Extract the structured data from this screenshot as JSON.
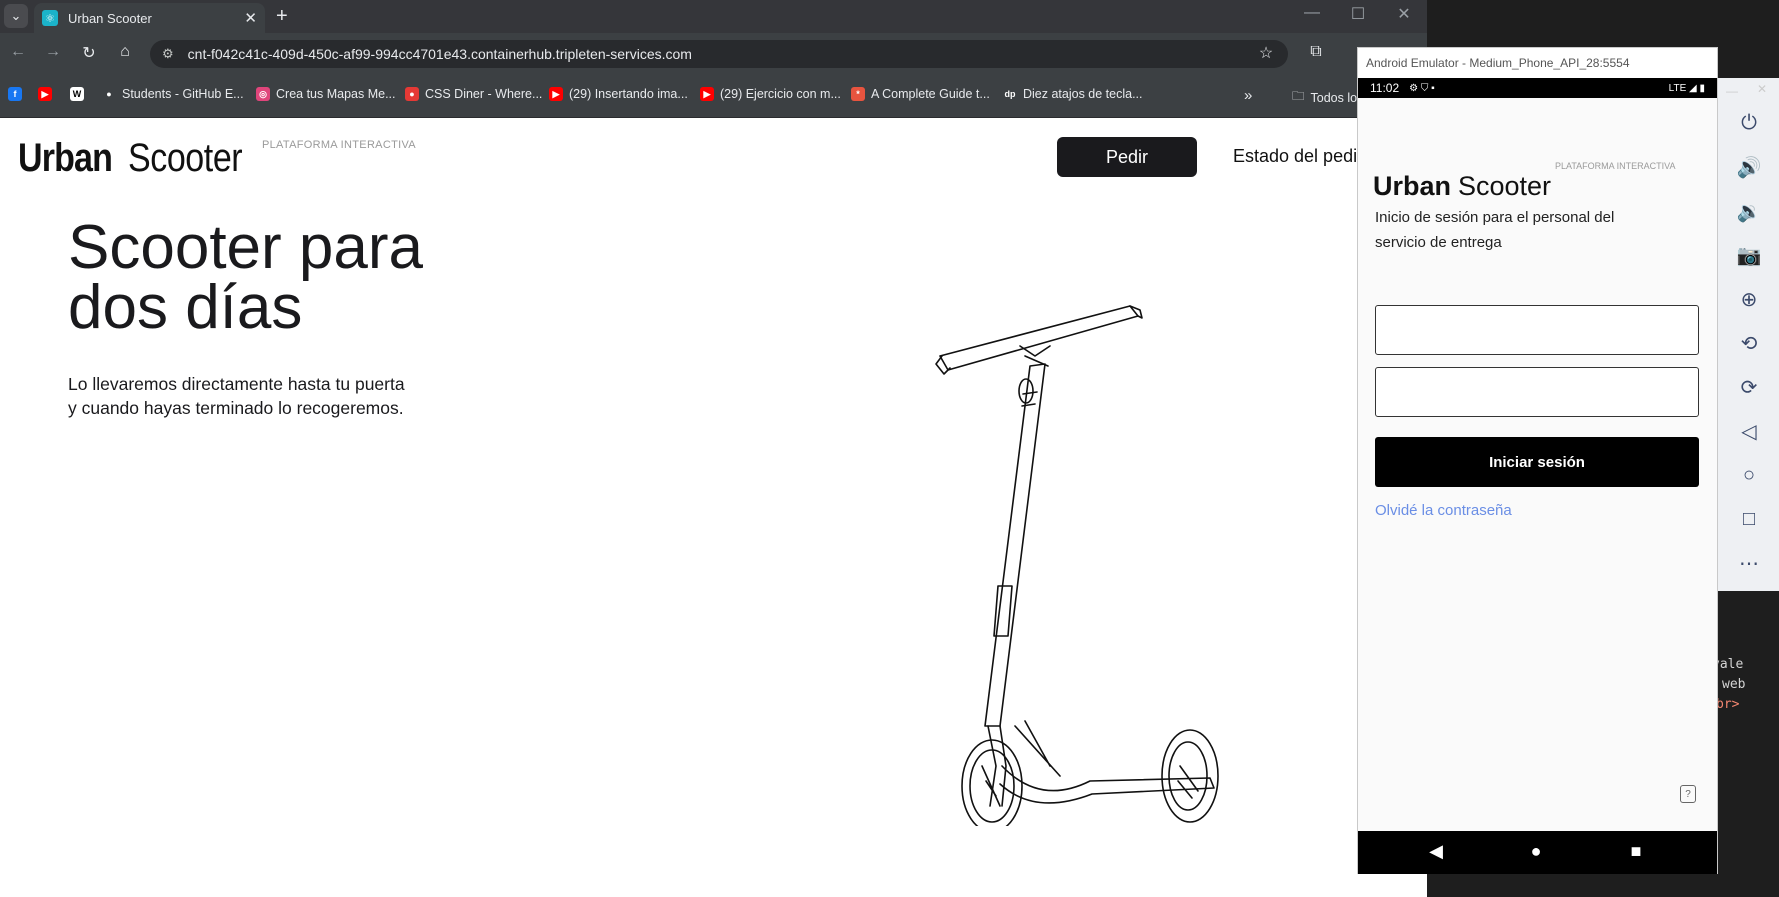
{
  "browser": {
    "tab_title": "Urban Scooter",
    "url": "cnt-f042c41c-409d-450c-af99-994cc4701e43.containerhub.tripleten-services.com",
    "bookmarks": [
      {
        "label": "",
        "icon": "facebook-icon",
        "color": "#1877f2"
      },
      {
        "label": "",
        "icon": "youtube-icon",
        "color": "#ff0000"
      },
      {
        "label": "",
        "icon": "wikipedia-icon",
        "color": "#ffffff"
      },
      {
        "label": "Students - GitHub E...",
        "icon": "github-icon",
        "color": "#ffffff"
      },
      {
        "label": "Crea tus Mapas Me...",
        "icon": "maps-icon",
        "color": "#e0457b"
      },
      {
        "label": "CSS Diner - Where...",
        "icon": "css-diner-icon",
        "color": "#e53935"
      },
      {
        "label": "(29) Insertando ima...",
        "icon": "youtube-icon",
        "color": "#ff0000"
      },
      {
        "label": "(29) Ejercicio con m...",
        "icon": "youtube-icon",
        "color": "#ff0000"
      },
      {
        "label": "A Complete Guide t...",
        "icon": "css-tricks-icon",
        "color": "#e8543f"
      },
      {
        "label": "Diez atajos de tecla...",
        "icon": "dp-icon",
        "color": "#9aa0a6"
      }
    ],
    "more_bookmarks": "»",
    "all_bookmarks": "Todos lo"
  },
  "page": {
    "logo_bold": "Urban",
    "logo_light": "Scooter",
    "logo_tag": "PLATAFORMA INTERACTIVA",
    "order_button": "Pedir",
    "status_link": "Estado del pedi",
    "hero_title_line1": "Scooter para",
    "hero_title_line2": "dos días",
    "hero_sub_line1": "Lo llevaremos directamente hasta tu puerta",
    "hero_sub_line2": "y cuando hayas terminado lo recogeremos."
  },
  "emulator": {
    "window_title": "Android Emulator - Medium_Phone_API_28:5554",
    "time": "11:02",
    "network": "LTE",
    "tools": [
      "power-icon",
      "volume-up-icon",
      "volume-down-icon",
      "camera-icon",
      "zoom-icon",
      "rotate-left-icon",
      "rotate-right-icon",
      "back-icon",
      "home-icon",
      "overview-icon",
      "more-icon"
    ],
    "app": {
      "tag": "PLATAFORMA INTERACTIVA",
      "logo_bold": "Urban",
      "logo_light": "Scooter",
      "subtitle": "Inicio de sesión para el personal del servicio de entrega",
      "login_input_value": "",
      "password_input_value": "",
      "login_button": "Iniciar sesión",
      "forgot_link": "Olvidé la contraseña"
    }
  },
  "editor_snippet": {
    "line1": "vale",
    "line2": "web",
    "line3": "br>"
  }
}
